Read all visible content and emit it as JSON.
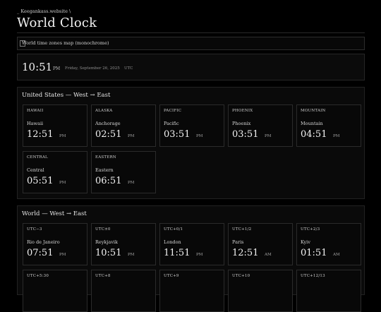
{
  "breadcrumb": "_ Keegankass.website \\",
  "page_title": "World Clock",
  "map_alt": "World time zones map (monochrome)",
  "utc_clock": {
    "time": "10:51",
    "ampm": "PM",
    "date": "Friday, September 26, 2025",
    "zone": "UTC"
  },
  "us_section": {
    "title": "United States — West → East",
    "cards": [
      {
        "abbr": "HAWAII",
        "city": "Hawaii",
        "time": "12:51",
        "ampm": "PM"
      },
      {
        "abbr": "ALASKA",
        "city": "Anchorage",
        "time": "02:51",
        "ampm": "PM"
      },
      {
        "abbr": "PACIFIC",
        "city": "Pacific",
        "time": "03:51",
        "ampm": "PM"
      },
      {
        "abbr": "PHOENIX",
        "city": "Phoenix",
        "time": "03:51",
        "ampm": "PM"
      },
      {
        "abbr": "MOUNTAIN",
        "city": "Mountain",
        "time": "04:51",
        "ampm": "PM"
      },
      {
        "abbr": "CENTRAL",
        "city": "Central",
        "time": "05:51",
        "ampm": "PM"
      },
      {
        "abbr": "EASTERN",
        "city": "Eastern",
        "time": "06:51",
        "ampm": "PM"
      }
    ]
  },
  "world_section": {
    "title": "World — West → East",
    "cards": [
      {
        "abbr": "UTC−3",
        "city": "Rio de Janeiro",
        "time": "07:51",
        "ampm": "PM"
      },
      {
        "abbr": "UTC±0",
        "city": "Reykjavik",
        "time": "10:51",
        "ampm": "PM"
      },
      {
        "abbr": "UTC+0/1",
        "city": "London",
        "time": "11:51",
        "ampm": "PM"
      },
      {
        "abbr": "UTC+1/2",
        "city": "Paris",
        "time": "12:51",
        "ampm": "AM"
      },
      {
        "abbr": "UTC+2/3",
        "city": "Kyiv",
        "time": "01:51",
        "ampm": "AM"
      },
      {
        "abbr": "UTC+5:30",
        "city": "",
        "time": "",
        "ampm": ""
      },
      {
        "abbr": "UTC+8",
        "city": "",
        "time": "",
        "ampm": ""
      },
      {
        "abbr": "UTC+9",
        "city": "",
        "time": "",
        "ampm": ""
      },
      {
        "abbr": "UTC+10",
        "city": "",
        "time": "",
        "ampm": ""
      },
      {
        "abbr": "UTC+12/13",
        "city": "",
        "time": "",
        "ampm": ""
      }
    ]
  }
}
